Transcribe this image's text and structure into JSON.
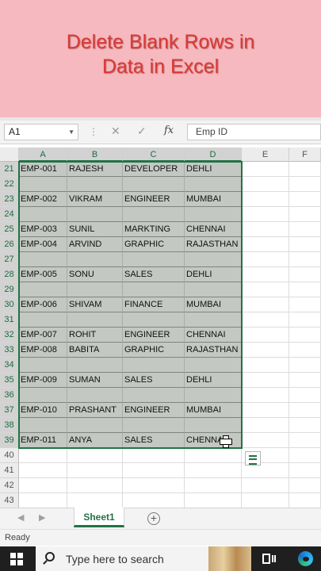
{
  "banner": {
    "title": "Delete Blank Rows in\nData in Excel",
    "background": "#f5b9bf",
    "text_color": "#d93a35"
  },
  "formula_bar": {
    "name_box": "A1",
    "cancel_icon": "close-icon",
    "enter_icon": "check-icon",
    "fx_label": "fx",
    "content": "Emp ID"
  },
  "grid": {
    "columns": [
      "A",
      "B",
      "C",
      "D",
      "E",
      "F"
    ],
    "rows": [
      {
        "num": "21",
        "cells": [
          "EMP-001",
          "RAJESH",
          "DEVELOPER",
          "DEHLI"
        ]
      },
      {
        "num": "22",
        "cells": [
          "",
          "",
          "",
          ""
        ]
      },
      {
        "num": "23",
        "cells": [
          "EMP-002",
          "VIKRAM",
          "ENGINEER",
          "MUMBAI"
        ]
      },
      {
        "num": "24",
        "cells": [
          "",
          "",
          "",
          ""
        ]
      },
      {
        "num": "25",
        "cells": [
          "EMP-003",
          "SUNIL",
          "MARKTING",
          "CHENNAI"
        ]
      },
      {
        "num": "26",
        "cells": [
          "EMP-004",
          "ARVIND",
          "GRAPHIC",
          "RAJASTHAN"
        ]
      },
      {
        "num": "27",
        "cells": [
          "",
          "",
          "",
          ""
        ]
      },
      {
        "num": "28",
        "cells": [
          "EMP-005",
          "SONU",
          "SALES",
          "DEHLI"
        ]
      },
      {
        "num": "29",
        "cells": [
          "",
          "",
          "",
          ""
        ]
      },
      {
        "num": "30",
        "cells": [
          "EMP-006",
          "SHIVAM",
          "FINANCE",
          "MUMBAI"
        ]
      },
      {
        "num": "31",
        "cells": [
          "",
          "",
          "",
          ""
        ]
      },
      {
        "num": "32",
        "cells": [
          "EMP-007",
          "ROHIT",
          "ENGINEER",
          "CHENNAI"
        ]
      },
      {
        "num": "33",
        "cells": [
          "EMP-008",
          "BABITA",
          "GRAPHIC",
          "RAJASTHAN"
        ]
      },
      {
        "num": "34",
        "cells": [
          "",
          "",
          "",
          ""
        ]
      },
      {
        "num": "35",
        "cells": [
          "EMP-009",
          "SUMAN",
          "SALES",
          "DEHLI"
        ]
      },
      {
        "num": "36",
        "cells": [
          "",
          "",
          "",
          ""
        ]
      },
      {
        "num": "37",
        "cells": [
          "EMP-010",
          "PRASHANT",
          "ENGINEER",
          "MUMBAI"
        ]
      },
      {
        "num": "38",
        "cells": [
          "",
          "",
          "",
          ""
        ]
      },
      {
        "num": "39",
        "cells": [
          "EMP-011",
          "ANYA",
          "SALES",
          "CHENNAI"
        ]
      },
      {
        "num": "40",
        "cells": [
          "",
          "",
          "",
          ""
        ]
      },
      {
        "num": "41",
        "cells": [
          "",
          "",
          "",
          ""
        ]
      },
      {
        "num": "42",
        "cells": [
          "",
          "",
          "",
          ""
        ]
      },
      {
        "num": "43",
        "cells": [
          "",
          "",
          "",
          ""
        ]
      }
    ],
    "selected_rows": 19,
    "selection_color": "#217346"
  },
  "sheet_tabs": {
    "active_tab": "Sheet1",
    "add_icon": "plus-icon"
  },
  "status_bar": {
    "text": "Ready"
  },
  "taskbar": {
    "search_placeholder": "Type here to search",
    "start_icon": "windows-icon",
    "taskview_icon": "task-view-icon",
    "browser_icon": "edge-icon"
  }
}
